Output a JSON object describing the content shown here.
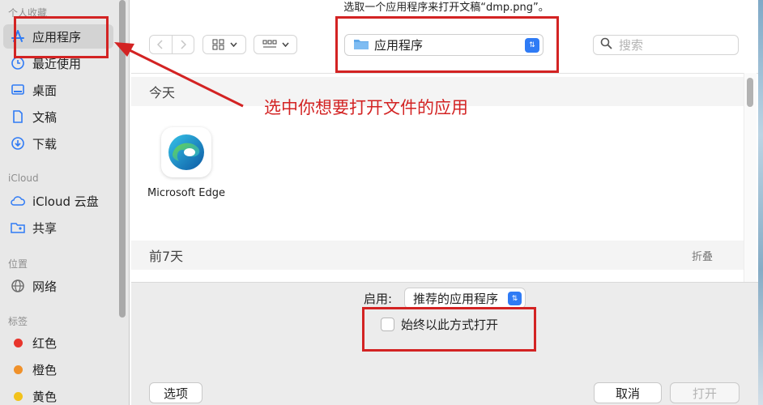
{
  "dialog": {
    "title": "选取一个应用程序来打开文稿“dmp.png”。"
  },
  "sidebar": {
    "sections": {
      "favorites": "个人收藏",
      "icloud": "iCloud",
      "locations": "位置",
      "tags": "标签"
    },
    "favorites": [
      {
        "label": "应用程序",
        "icon": "app-store-icon",
        "selected": true
      },
      {
        "label": "最近使用",
        "icon": "clock-icon"
      },
      {
        "label": "桌面",
        "icon": "desktop-icon"
      },
      {
        "label": "文稿",
        "icon": "document-icon"
      },
      {
        "label": "下载",
        "icon": "download-icon"
      }
    ],
    "icloud": [
      {
        "label": "iCloud 云盘",
        "icon": "cloud-icon"
      },
      {
        "label": "共享",
        "icon": "shared-folder-icon"
      }
    ],
    "locations": [
      {
        "label": "网络",
        "icon": "globe-icon"
      }
    ],
    "tags": [
      {
        "label": "红色",
        "color": "#e8352c"
      },
      {
        "label": "橙色",
        "color": "#f0912a"
      },
      {
        "label": "黄色",
        "color": "#f2c21b"
      }
    ]
  },
  "toolbar": {
    "location": "应用程序",
    "search_placeholder": "搜索"
  },
  "list": {
    "groups": [
      {
        "title": "今天",
        "items": [
          {
            "name": "Microsoft Edge"
          }
        ]
      },
      {
        "title": "前7天",
        "collapse_label": "折叠"
      }
    ]
  },
  "options": {
    "enable_label": "启用:",
    "enable_value": "推荐的应用程序",
    "always_label": "始终以此方式打开",
    "always_checked": false
  },
  "buttons": {
    "options": "选项",
    "cancel": "取消",
    "open": "打开"
  },
  "annotation": {
    "text": "选中你想要打开文件的应用",
    "color": "#d32323"
  },
  "colors": {
    "accent": "#2f7bf5",
    "sidebar_bg": "#e8e8e8"
  }
}
